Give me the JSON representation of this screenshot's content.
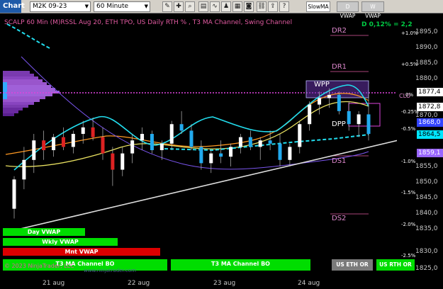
{
  "toolbar": {
    "chart_button": "Chart",
    "instrument": "M2K 09-23",
    "interval": "60 Minute",
    "icons": [
      "draw-icon",
      "crosshair-icon",
      "zoom-icon",
      "properties-icon",
      "indicators-icon",
      "strategies-icon",
      "templates-icon",
      "screenshot-icon",
      "help-icon"
    ],
    "tabs": [
      "SlowMA",
      "D VWAP",
      "W VWAP"
    ]
  },
  "title": "SCALP 60 Min (M)RSSL Aug 20, ETH TPO, US Daily RTH % , T3 MA Channel, Swing Channel",
  "status_value": "D 0,12% = 2,2",
  "price_ticks": [
    "1895,0",
    "1890,0",
    "1885,0",
    "1880,0",
    "1875,0",
    "1870,0",
    "1865,0",
    "1860,0",
    "1855,0",
    "1850,0",
    "1845,0",
    "1840,0",
    "1835,0",
    "1830,0",
    "1825,0"
  ],
  "price_labels": [
    {
      "value": "1877,4",
      "bg": "#ffffff",
      "fg": "#000000"
    },
    {
      "value": "1872,8",
      "bg": "#ffffff",
      "fg": "#000000"
    },
    {
      "value": "1868,0",
      "bg": "#3344ff",
      "fg": "#ffffff"
    },
    {
      "value": "1864,5",
      "bg": "#00e5ff",
      "fg": "#000000"
    },
    {
      "value": "1859,1",
      "bg": "#9966ff",
      "fg": "#ffffff"
    }
  ],
  "percent_labels": [
    "+1.0%",
    "+0.5%",
    "0%",
    "-0.25%",
    "-0.5%",
    "-1.0%",
    "-1.5%",
    "-2.0%",
    "-2.5%"
  ],
  "levels": [
    "DR2",
    "DR1",
    "WPP",
    "CLO",
    "DPP",
    "DS1",
    "DS2"
  ],
  "dates": [
    "21 aug",
    "22 aug",
    "23 aug",
    "24 aug"
  ],
  "vwap_bars": [
    {
      "label": "Day VWAP",
      "color": "#00dd00"
    },
    {
      "label": "Wkly VWAP",
      "color": "#00dd00"
    },
    {
      "label": "Mnt VWAP",
      "color": "#dd0000"
    }
  ],
  "channel_bars": [
    {
      "label": "T3 MA Channel BO",
      "color": "#00dd00"
    },
    {
      "label": "T3 MA Channel BO",
      "color": "#00dd00"
    }
  ],
  "session_buttons": [
    {
      "label": "US ETH OR",
      "color": "#7a7a7a"
    },
    {
      "label": "US RTH OR",
      "color": "#00dd00"
    }
  ],
  "copyright": "© 2023 NinjaTrader, LLC",
  "watermark": "www.ninjatrader.com",
  "chart_data": {
    "type": "candlestick",
    "ylim": [
      1824,
      1898
    ],
    "x_labels": [
      "21 aug",
      "22 aug",
      "23 aug",
      "24 aug"
    ],
    "candles": [
      {
        "o": 1843,
        "h": 1853,
        "l": 1840,
        "c": 1852
      },
      {
        "o": 1852,
        "h": 1862,
        "l": 1849,
        "c": 1858
      },
      {
        "o": 1858,
        "h": 1866,
        "l": 1854,
        "c": 1864
      },
      {
        "o": 1864,
        "h": 1867,
        "l": 1858,
        "c": 1861
      },
      {
        "o": 1861,
        "h": 1866,
        "l": 1859,
        "c": 1865
      },
      {
        "o": 1865,
        "h": 1868,
        "l": 1861,
        "c": 1862
      },
      {
        "o": 1862,
        "h": 1867,
        "l": 1860,
        "c": 1866
      },
      {
        "o": 1866,
        "h": 1870,
        "l": 1863,
        "c": 1868
      },
      {
        "o": 1868,
        "h": 1871,
        "l": 1864,
        "c": 1865
      },
      {
        "o": 1865,
        "h": 1868,
        "l": 1858,
        "c": 1860
      },
      {
        "o": 1860,
        "h": 1862,
        "l": 1850,
        "c": 1855
      },
      {
        "o": 1855,
        "h": 1862,
        "l": 1853,
        "c": 1860
      },
      {
        "o": 1860,
        "h": 1866,
        "l": 1857,
        "c": 1864
      },
      {
        "o": 1864,
        "h": 1868,
        "l": 1861,
        "c": 1866
      },
      {
        "o": 1866,
        "h": 1867,
        "l": 1860,
        "c": 1861
      },
      {
        "o": 1861,
        "h": 1864,
        "l": 1858,
        "c": 1863
      },
      {
        "o": 1863,
        "h": 1870,
        "l": 1861,
        "c": 1869
      },
      {
        "o": 1869,
        "h": 1873,
        "l": 1866,
        "c": 1867
      },
      {
        "o": 1867,
        "h": 1869,
        "l": 1861,
        "c": 1862
      },
      {
        "o": 1862,
        "h": 1864,
        "l": 1855,
        "c": 1857
      },
      {
        "o": 1857,
        "h": 1861,
        "l": 1854,
        "c": 1860
      },
      {
        "o": 1860,
        "h": 1864,
        "l": 1857,
        "c": 1859
      },
      {
        "o": 1859,
        "h": 1863,
        "l": 1856,
        "c": 1862
      },
      {
        "o": 1862,
        "h": 1866,
        "l": 1860,
        "c": 1865
      },
      {
        "o": 1865,
        "h": 1867,
        "l": 1861,
        "c": 1862
      },
      {
        "o": 1862,
        "h": 1865,
        "l": 1858,
        "c": 1864
      },
      {
        "o": 1864,
        "h": 1867,
        "l": 1861,
        "c": 1863
      },
      {
        "o": 1863,
        "h": 1866,
        "l": 1856,
        "c": 1858
      },
      {
        "o": 1858,
        "h": 1863,
        "l": 1856,
        "c": 1862
      },
      {
        "o": 1862,
        "h": 1870,
        "l": 1860,
        "c": 1869
      },
      {
        "o": 1869,
        "h": 1876,
        "l": 1867,
        "c": 1875
      },
      {
        "o": 1875,
        "h": 1879,
        "l": 1872,
        "c": 1877
      },
      {
        "o": 1877,
        "h": 1880,
        "l": 1874,
        "c": 1878
      },
      {
        "o": 1878,
        "h": 1879,
        "l": 1872,
        "c": 1873
      },
      {
        "o": 1873,
        "h": 1876,
        "l": 1867,
        "c": 1869
      },
      {
        "o": 1869,
        "h": 1873,
        "l": 1865,
        "c": 1872
      },
      {
        "o": 1872,
        "h": 1878,
        "l": 1864,
        "c": 1866
      }
    ]
  }
}
